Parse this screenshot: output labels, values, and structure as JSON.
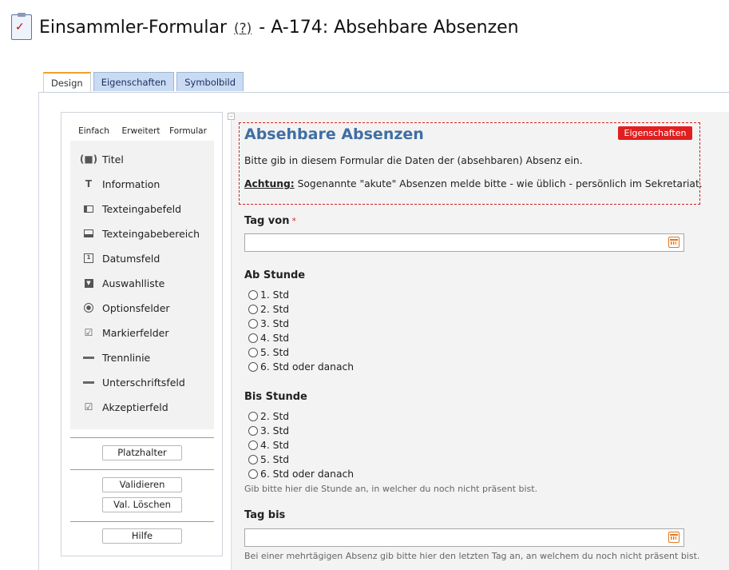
{
  "header": {
    "title_main": "Einsammler-Formular",
    "help": "(?)",
    "title_rest": " - A-174: Absehbare Absenzen"
  },
  "tabs": [
    "Design",
    "Eigenschaften",
    "Symbolbild"
  ],
  "palette": {
    "tabs": [
      "Einfach",
      "Erweitert",
      "Formular"
    ],
    "items": [
      {
        "label": "Titel",
        "icon": "title-icon"
      },
      {
        "label": "Information",
        "icon": "text-icon"
      },
      {
        "label": "Texteingabefeld",
        "icon": "textfield-icon"
      },
      {
        "label": "Texteingabebereich",
        "icon": "textarea-icon"
      },
      {
        "label": "Datumsfeld",
        "icon": "calendar-icon"
      },
      {
        "label": "Auswahlliste",
        "icon": "dropdown-icon"
      },
      {
        "label": "Optionsfelder",
        "icon": "radio-icon"
      },
      {
        "label": "Markierfelder",
        "icon": "checkbox-icon"
      },
      {
        "label": "Trennlinie",
        "icon": "divider-icon"
      },
      {
        "label": "Unterschriftsfeld",
        "icon": "signature-icon"
      },
      {
        "label": "Akzeptierfeld",
        "icon": "accept-icon"
      }
    ],
    "buttons": {
      "placeholder": "Platzhalter",
      "validate": "Validieren",
      "clear_validation": "Val. Löschen",
      "help": "Hilfe"
    }
  },
  "form": {
    "title": "Absehbare Absenzen",
    "properties_button": "Eigenschaften",
    "intro": "Bitte gib in diesem Formular die Daten der (absehbaren) Absenz ein.",
    "note_label": "Achtung:",
    "note_text": " Sogenannte \"akute\" Absenzen melde bitte - wie üblich - persönlich im Sekretariat.",
    "fields": {
      "tag_von": {
        "label": "Tag von",
        "required_mark": "*",
        "value": ""
      },
      "ab_stunde": {
        "label": "Ab Stunde",
        "options": [
          "1. Std",
          "2. Std",
          "3. Std",
          "4. Std",
          "5. Std",
          "6. Std oder danach"
        ]
      },
      "bis_stunde": {
        "label": "Bis Stunde",
        "options": [
          "2. Std",
          "3. Std",
          "4. Std",
          "5. Std",
          "6. Std oder danach"
        ],
        "hint": "Gib bitte hier die Stunde an, in welcher du noch nicht präsent bist."
      },
      "tag_bis": {
        "label": "Tag bis",
        "value": "",
        "hint": "Bei einer mehrtägigen Absenz gib bitte hier den letzten Tag an, an welchem du noch nicht präsent bist."
      }
    }
  },
  "colors": {
    "accent_title": "#3f6fa3",
    "danger": "#e02020",
    "tab_active_top": "#f0a030",
    "calendar": "#e07820"
  }
}
